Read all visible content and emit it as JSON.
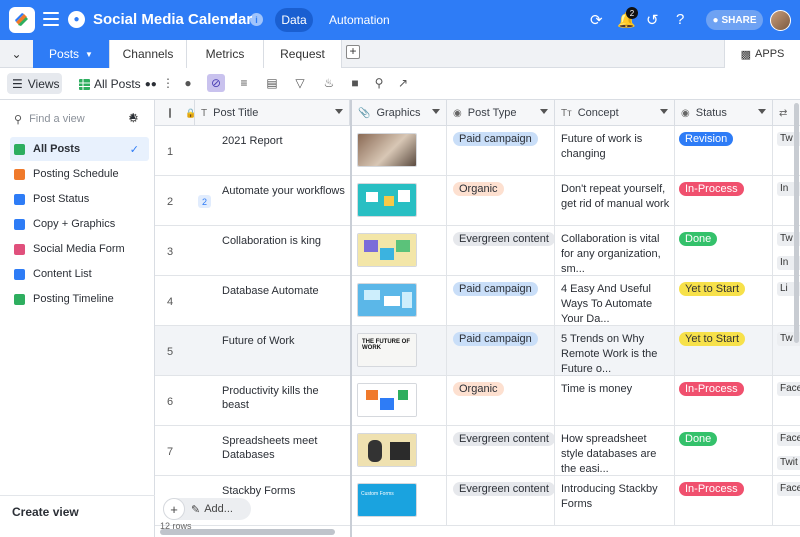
{
  "app": {
    "title": "Social Media Calendar",
    "nav_tabs": [
      "Data",
      "Automation"
    ],
    "notifications_count": "2",
    "share_label": "SHARE"
  },
  "tables": {
    "tabs": [
      "Posts",
      "Channels",
      "Metrics",
      "Request"
    ],
    "apps_label": "APPS"
  },
  "toolbar": {
    "views_label": "Views",
    "current_view": "All Posts"
  },
  "sidebar": {
    "find_placeholder": "Find a view",
    "items": [
      {
        "label": "All Posts",
        "icon": "grid-icon",
        "color": "#2eae5f",
        "active": true
      },
      {
        "label": "Posting Schedule",
        "icon": "calendar-icon",
        "color": "#f07a2b",
        "active": false
      },
      {
        "label": "Post Status",
        "icon": "kanban-icon",
        "color": "#2e7cf6",
        "active": false
      },
      {
        "label": "Copy + Graphics",
        "icon": "gallery-icon",
        "color": "#2e7cf6",
        "active": false
      },
      {
        "label": "Social Media Form",
        "icon": "form-icon",
        "color": "#e0507c",
        "active": false
      },
      {
        "label": "Content List",
        "icon": "list-icon",
        "color": "#2e7cf6",
        "active": false
      },
      {
        "label": "Posting Timeline",
        "icon": "timeline-icon",
        "color": "#2eae5f",
        "active": false
      }
    ],
    "create_view_label": "Create view"
  },
  "grid": {
    "columns": [
      "Post Title",
      "Graphics",
      "Post Type",
      "Concept",
      "Status",
      ""
    ],
    "rows": [
      {
        "num": "1",
        "comments": "",
        "title": "2021 Report",
        "post_type": "Paid campaign",
        "concept": "Future of work is changing",
        "status": "Revision",
        "extra": [
          "Tw"
        ]
      },
      {
        "num": "2",
        "comments": "2",
        "title": "Automate your workflows",
        "post_type": "Organic",
        "concept": "Don't repeat yourself, get rid of manual work",
        "status": "In-Process",
        "extra": [
          "In"
        ]
      },
      {
        "num": "3",
        "comments": "",
        "title": "Collaboration is king",
        "post_type": "Evergreen content",
        "concept": "Collaboration is vital for any organization, sm...",
        "status": "Done",
        "extra": [
          "Tw",
          "In"
        ]
      },
      {
        "num": "4",
        "comments": "",
        "title": "Database Automate",
        "post_type": "Paid campaign",
        "concept": "4 Easy And Useful Ways To Automate Your Da...",
        "status": "Yet to Start",
        "extra": [
          "Li"
        ]
      },
      {
        "num": "5",
        "comments": "",
        "title": "Future of Work",
        "post_type": "Paid campaign",
        "concept": "5 Trends on Why Remote Work is the Future o...",
        "status": "Yet to Start",
        "extra": [
          "Tw"
        ]
      },
      {
        "num": "6",
        "comments": "",
        "title": "Productivity kills the beast",
        "post_type": "Organic",
        "concept": "Time is money",
        "status": "In-Process",
        "extra": [
          "Face"
        ]
      },
      {
        "num": "7",
        "comments": "",
        "title": "Spreadsheets meet Databases",
        "post_type": "Evergreen content",
        "concept": "How spreadsheet style databases are the easi...",
        "status": "Done",
        "extra": [
          "Face",
          "Twit"
        ]
      },
      {
        "num": "",
        "comments": "",
        "title": "Stackby Forms",
        "post_type": "Evergreen content",
        "concept": "Introducing Stackby Forms",
        "status": "In-Process",
        "extra": [
          "Face"
        ]
      }
    ],
    "thumb_texts": {
      "future_of_work": "THE FUTURE OF WORK",
      "forms": "Custom Forms"
    },
    "add_label": "Add...",
    "row_count_label": "12 rows"
  },
  "colors": {
    "primary": "#2e7cf6",
    "type_paid": "#c9def8",
    "type_organic": "#fde0d0",
    "type_evergreen": "#e6e8ec",
    "status_revision": "#2e7cf6",
    "status_inprocess": "#f0506e",
    "status_done": "#34c16b",
    "status_yet": "#f7e14a"
  }
}
